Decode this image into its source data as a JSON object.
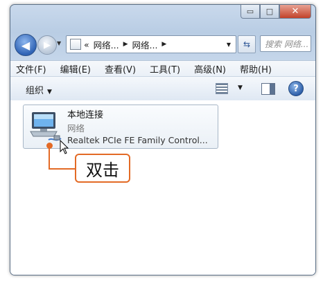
{
  "window": {
    "caption_buttons": {
      "minimize": "▭",
      "maximize": "□",
      "close": "✕"
    }
  },
  "nav": {
    "address_crumbs": [
      "«",
      "网络...",
      "网络..."
    ],
    "search_placeholder": "搜索 网络..."
  },
  "menu": [
    "文件(F)",
    "编辑(E)",
    "查看(V)",
    "工具(T)",
    "高级(N)",
    "帮助(H)"
  ],
  "toolbar": {
    "organize_label": "组织"
  },
  "item": {
    "name": "本地连接",
    "status": "网络",
    "device": "Realtek PCIe FE Family Control..."
  },
  "callout": "双击",
  "colors": {
    "accent": "#e36a25",
    "frame": "#c5d6ea"
  }
}
